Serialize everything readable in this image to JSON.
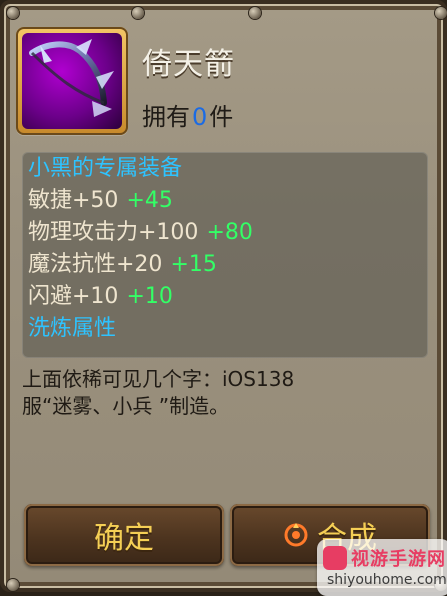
{
  "item": {
    "name": "倚天箭",
    "owned_prefix": "拥有",
    "owned_count": "0",
    "owned_suffix": "件",
    "icon": "bow-weapon-icon"
  },
  "stats": {
    "section_exclusive": "小黑的专属装备",
    "lines": [
      {
        "label": "敏捷+50",
        "bonus": "+45"
      },
      {
        "label": "物理攻击力+100",
        "bonus": "+80"
      },
      {
        "label": "魔法抗性+20",
        "bonus": "+15"
      },
      {
        "label": "闪避+10",
        "bonus": "+10"
      }
    ],
    "section_refine": "洗炼属性"
  },
  "description": {
    "line1": "上面依稀可见几个字：iOS138",
    "line2": "服“迷雾、小兵 ”制造。"
  },
  "buttons": {
    "confirm": "确定",
    "synthesize": "合成",
    "synthesize_icon": "merge-icon"
  },
  "watermark": {
    "line1": "视游手游网",
    "line2": "shiyouhome.com"
  },
  "colors": {
    "accent_green": "#33ff66",
    "section_blue": "#2ec3ff",
    "button_text": "#f5cf55",
    "count_blue": "#1b6be4"
  }
}
